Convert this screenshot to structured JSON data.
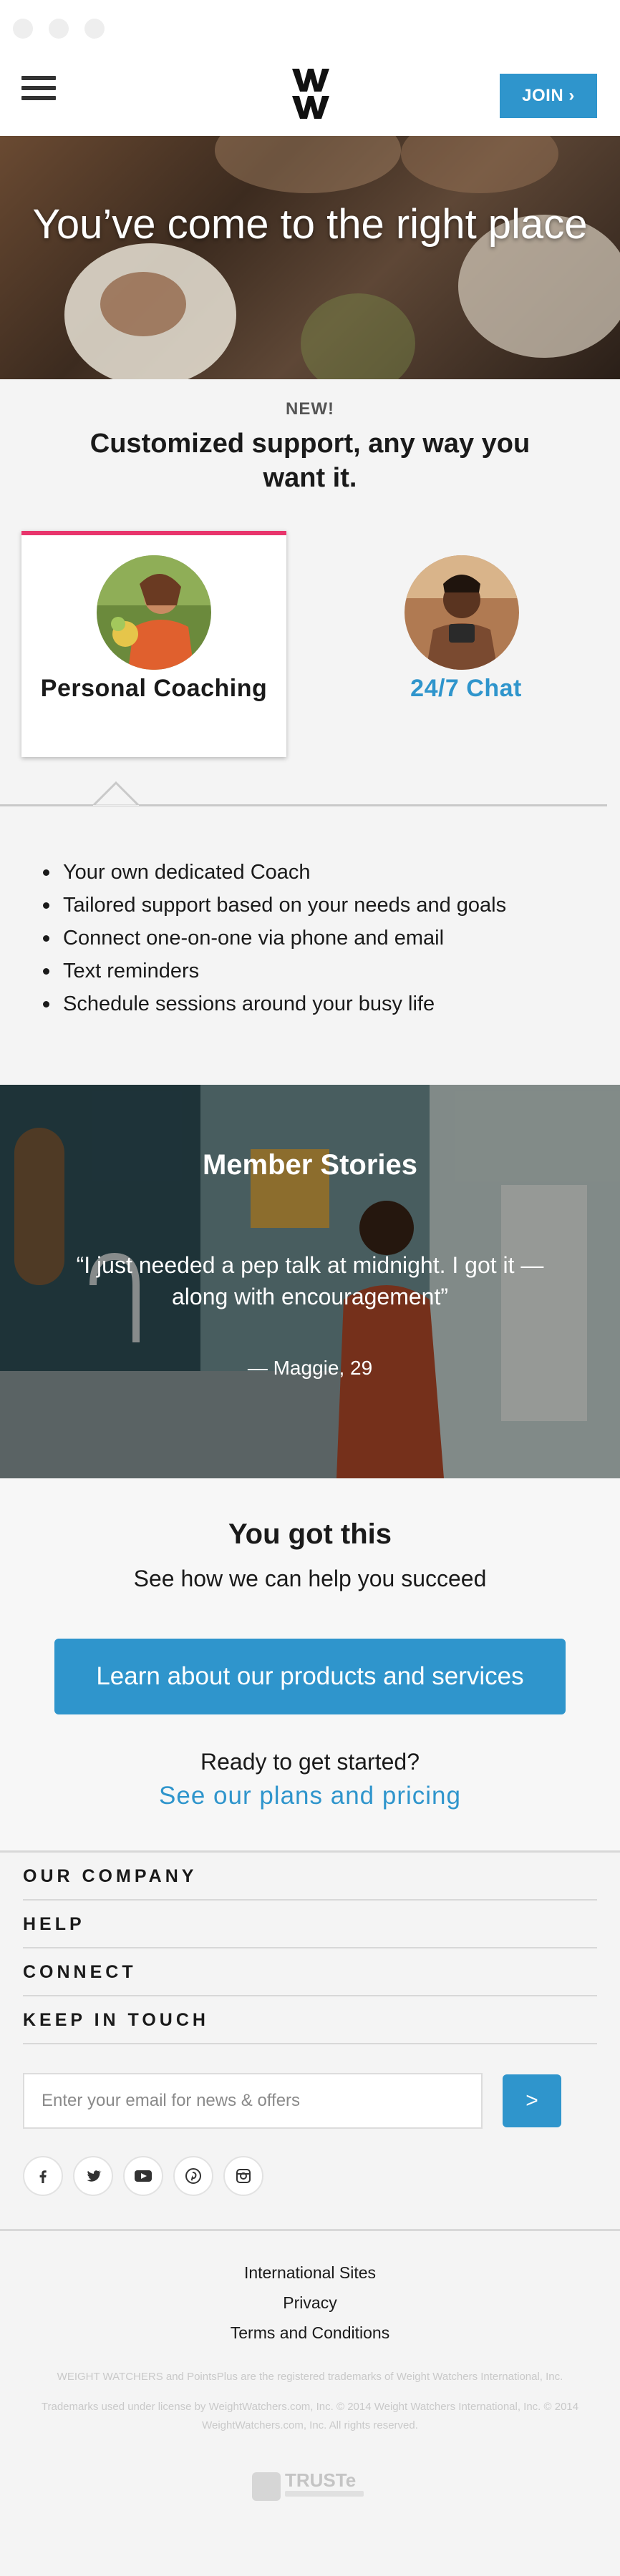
{
  "header": {
    "logo_text": "WW",
    "join_label": "JOIN ›"
  },
  "hero": {
    "title": "You’ve come to the right place"
  },
  "support": {
    "new_label": "NEW!",
    "title": "Customized support, any way you want it.",
    "cards": [
      {
        "label": "Personal Coaching",
        "selected": true
      },
      {
        "label": "24/7 Chat",
        "selected": false
      }
    ],
    "features": [
      "Your own dedicated Coach",
      "Tailored support based on your needs and goals",
      "Connect one-on-one via phone and email",
      "Text reminders",
      "Schedule sessions around your busy life"
    ]
  },
  "stories": {
    "title": "Member Stories",
    "quote": "“I just needed a pep talk at midnight. I got it — along with encouragement”",
    "attribution": "— Maggie, 29"
  },
  "cta": {
    "title": "You got this",
    "subtitle": "See how we can help you succeed",
    "button_label": "Learn about our products and services",
    "ready_text": "Ready to get started?",
    "plans_link": "See our plans and pricing"
  },
  "footer": {
    "nav": [
      "OUR COMPANY",
      "HELP",
      "CONNECT",
      "KEEP IN TOUCH"
    ],
    "email_placeholder": "Enter your email for news & offers",
    "submit_label": ">",
    "social_icons": [
      "facebook-icon",
      "twitter-icon",
      "youtube-icon",
      "pinterest-icon",
      "instagram-icon"
    ],
    "links": [
      "International Sites",
      "Privacy",
      "Terms and Conditions"
    ],
    "legal_1": "WEIGHT WATCHERS and PointsPlus are the registered trademarks of Weight Watchers International, Inc.",
    "legal_2": "Trademarks used under license by WeightWatchers.com, Inc. © 2014 Weight Watchers International, Inc. © 2014 WeightWatchers.com, Inc. All rights reserved.",
    "truste_label": "TRUSTe"
  },
  "colors": {
    "accent": "#2f95cc",
    "active_tab": "#e8356c",
    "text": "#1a1a1a"
  }
}
